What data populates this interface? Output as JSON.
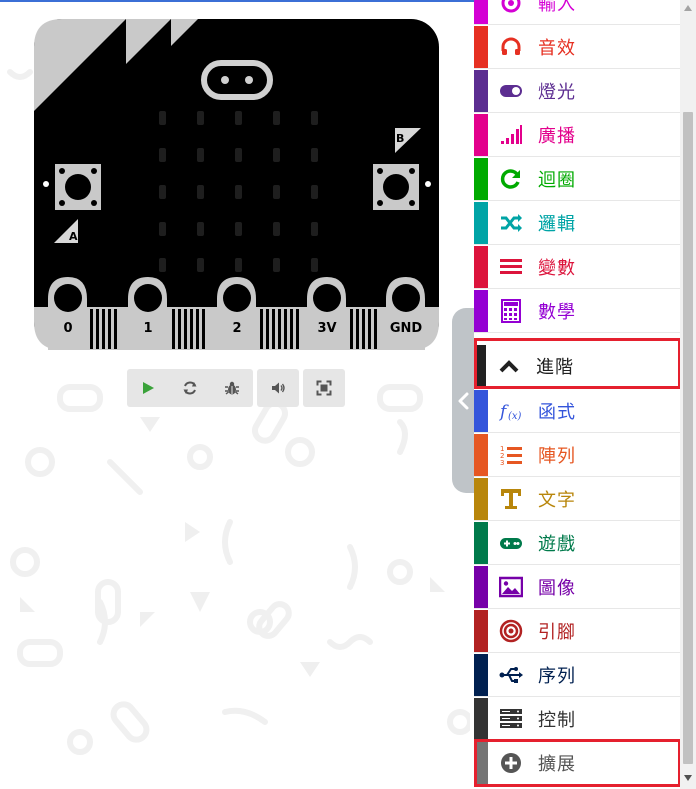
{
  "simulator": {
    "pins": [
      {
        "label": "0",
        "name": "pin-0"
      },
      {
        "label": "1",
        "name": "pin-1"
      },
      {
        "label": "2",
        "name": "pin-2"
      },
      {
        "label": "3V",
        "name": "pin-3v"
      },
      {
        "label": "GND",
        "name": "pin-gnd"
      }
    ],
    "button_a_label": "A",
    "button_b_label": "B",
    "toolbar": [
      {
        "name": "play-button",
        "icon": "play-icon",
        "color": "#3aa23a"
      },
      {
        "name": "restart-button",
        "icon": "restart-icon",
        "color": "#555555"
      },
      {
        "name": "debug-button",
        "icon": "bug-icon",
        "color": "#555555"
      },
      {
        "name": "mute-button",
        "icon": "speaker-icon",
        "color": "#555555"
      },
      {
        "name": "fullscreen-button",
        "icon": "fullscreen-icon",
        "color": "#555555"
      }
    ]
  },
  "toolbox": {
    "items": [
      {
        "label": "輸入",
        "color": "#d400d4",
        "icon": "input-icon"
      },
      {
        "label": "音效",
        "color": "#e63022",
        "icon": "headphones-icon"
      },
      {
        "label": "燈光",
        "color": "#5c2d91",
        "icon": "toggle-icon"
      },
      {
        "label": "廣播",
        "color": "#e3008c",
        "icon": "signal-bars-icon"
      },
      {
        "label": "迴圈",
        "color": "#00aa00",
        "icon": "loop-icon"
      },
      {
        "label": "邏輯",
        "color": "#00a4a6",
        "icon": "shuffle-icon"
      },
      {
        "label": "變數",
        "color": "#dc143c",
        "icon": "list-lines-icon"
      },
      {
        "label": "數學",
        "color": "#9400d3",
        "icon": "calculator-icon"
      },
      {
        "label": "進階",
        "color": "#212121",
        "icon": "chevron-up-icon"
      },
      {
        "label": "函式",
        "color": "#3455db",
        "icon": "function-icon"
      },
      {
        "label": "陣列",
        "color": "#e65722",
        "icon": "ordered-list-icon"
      },
      {
        "label": "文字",
        "color": "#b8860b",
        "icon": "text-icon"
      },
      {
        "label": "遊戲",
        "color": "#007a4b",
        "icon": "gamepad-icon"
      },
      {
        "label": "圖像",
        "color": "#7600a8",
        "icon": "image-icon"
      },
      {
        "label": "引腳",
        "color": "#b22222",
        "icon": "target-icon"
      },
      {
        "label": "序列",
        "color": "#002050",
        "icon": "usb-icon"
      },
      {
        "label": "控制",
        "color": "#333333",
        "icon": "server-icon"
      },
      {
        "label": "擴展",
        "color": "#757575",
        "icon": "plus-circle-icon"
      }
    ]
  },
  "collapse_handle": {
    "icon": "chevron-left-icon"
  }
}
